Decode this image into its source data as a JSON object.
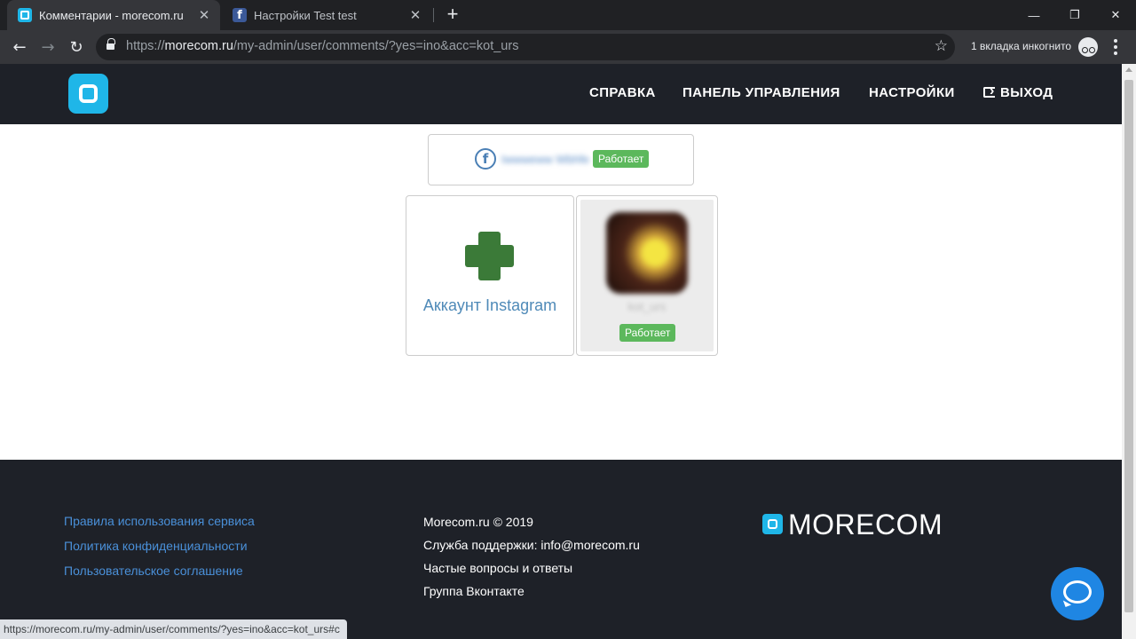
{
  "browser": {
    "tabs": [
      {
        "title": "Комментарии - morecom.ru",
        "icon": "morecom-favicon"
      },
      {
        "title": "Настройки Test test",
        "icon": "facebook-favicon"
      }
    ],
    "url": {
      "scheme": "https://",
      "host": "morecom.ru",
      "path": "/my-admin/user/comments/?yes=ino&acc=kot_urs"
    },
    "incognito_label": "1 вкладка инкогнито",
    "status_url": "https://morecom.ru/my-admin/user/comments/?yes=ino&acc=kot_urs#c"
  },
  "header": {
    "nav": {
      "help": "СПРАВКА",
      "dashboard": "ПАНЕЛЬ УПРАВЛЕНИЯ",
      "settings": "НАСТРОЙКИ",
      "logout": "ВЫХОД"
    }
  },
  "facebook_account": {
    "name": "Iwwweww Wbhfe",
    "status": "Работает"
  },
  "instagram": {
    "add_label": "Аккаунт Instagram",
    "account": {
      "name": "kot_urs",
      "status": "Работает"
    }
  },
  "footer": {
    "links": [
      "Правила использования сервиса",
      "Политика конфиденциальности",
      "Пользовательское соглашение"
    ],
    "info": [
      "Morecom.ru © 2019",
      "Служба поддержки: info@morecom.ru",
      "Частые вопросы и ответы",
      "Группа Вконтакте"
    ],
    "brand": "MORECOM"
  },
  "colors": {
    "brand": "#1fb6e8",
    "header_bg": "#1e2128",
    "success": "#5cb85c",
    "plus": "#3b7a38",
    "link": "#4a90d9",
    "chat": "#1f86e3"
  }
}
